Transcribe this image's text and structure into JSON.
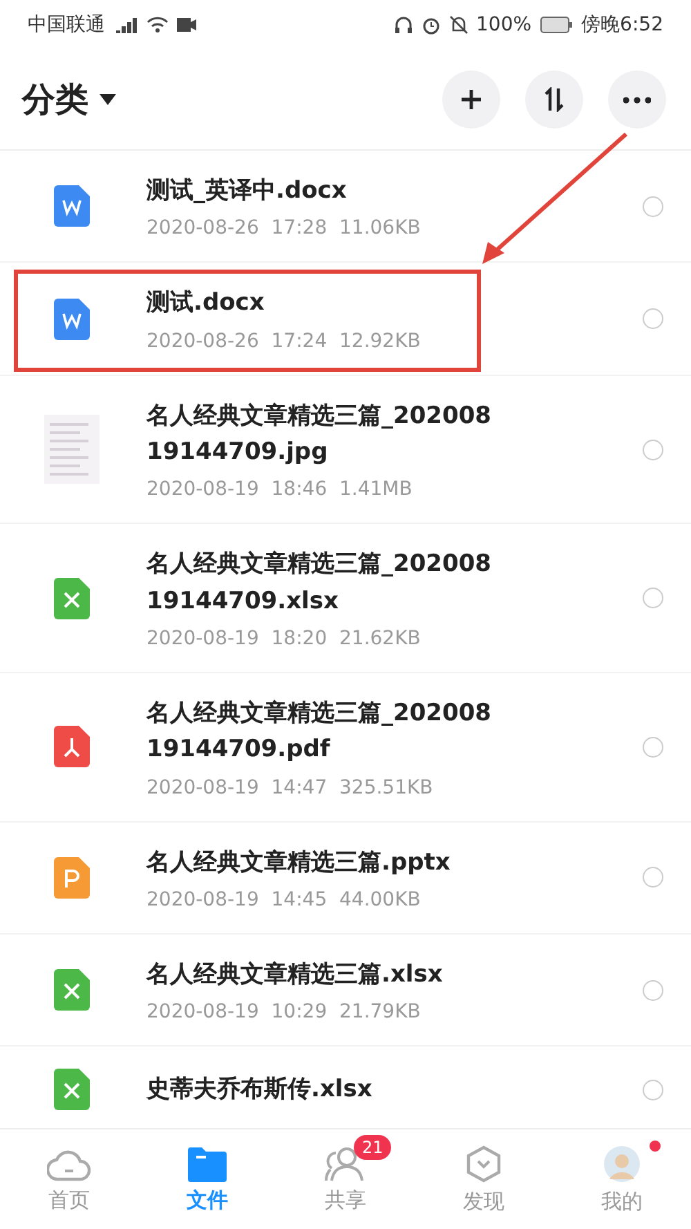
{
  "status_bar": {
    "carrier": "中国联通",
    "battery": "100%",
    "time": "傍晚6:52"
  },
  "header": {
    "title": "分类"
  },
  "files": [
    {
      "kind": "word",
      "name": "测试_英译中.docx",
      "meta": "2020-08-26  17:28  11.06KB",
      "highlighted": false,
      "selected": false
    },
    {
      "kind": "word",
      "name": "测试.docx",
      "meta": "2020-08-26  17:24  12.92KB",
      "highlighted": true,
      "selected": false
    },
    {
      "name": "名人经典文章精选三篇_20200819144709.jpg",
      "meta": "2020-08-19  18:46  1.41MB",
      "highlighted": false,
      "selected": false
    },
    {
      "kind": "excel",
      "name": "名人经典文章精选三篇_20200819144709.xlsx",
      "meta": "2020-08-19  18:20  21.62KB",
      "highlighted": false,
      "selected": false
    },
    {
      "kind": "pdf",
      "name": "名人经典文章精选三篇_20200819144709.pdf",
      "meta": "2020-08-19  14:47  325.51KB",
      "highlighted": false,
      "selected": false
    },
    {
      "kind": "ppt",
      "name": "名人经典文章精选三篇.pptx",
      "meta": "2020-08-19  14:45  44.00KB",
      "highlighted": false,
      "selected": false
    },
    {
      "kind": "excel",
      "name": "名人经典文章精选三篇.xlsx",
      "meta": "2020-08-19  10:29  21.79KB",
      "highlighted": false,
      "selected": false
    },
    {
      "kind": "excel",
      "name": "史蒂夫乔布斯传.xlsx",
      "highlighted": false,
      "selected": false
    }
  ],
  "tabs": [
    {
      "kind": "home",
      "label": "首页",
      "selected": false
    },
    {
      "kind": "files",
      "label": "文件",
      "selected": true
    },
    {
      "kind": "share",
      "label": "共享",
      "selected": false,
      "badge": "21"
    },
    {
      "kind": "discover",
      "label": "发现",
      "selected": false
    },
    {
      "kind": "me",
      "label": "我的",
      "selected": false,
      "dot": true
    }
  ]
}
